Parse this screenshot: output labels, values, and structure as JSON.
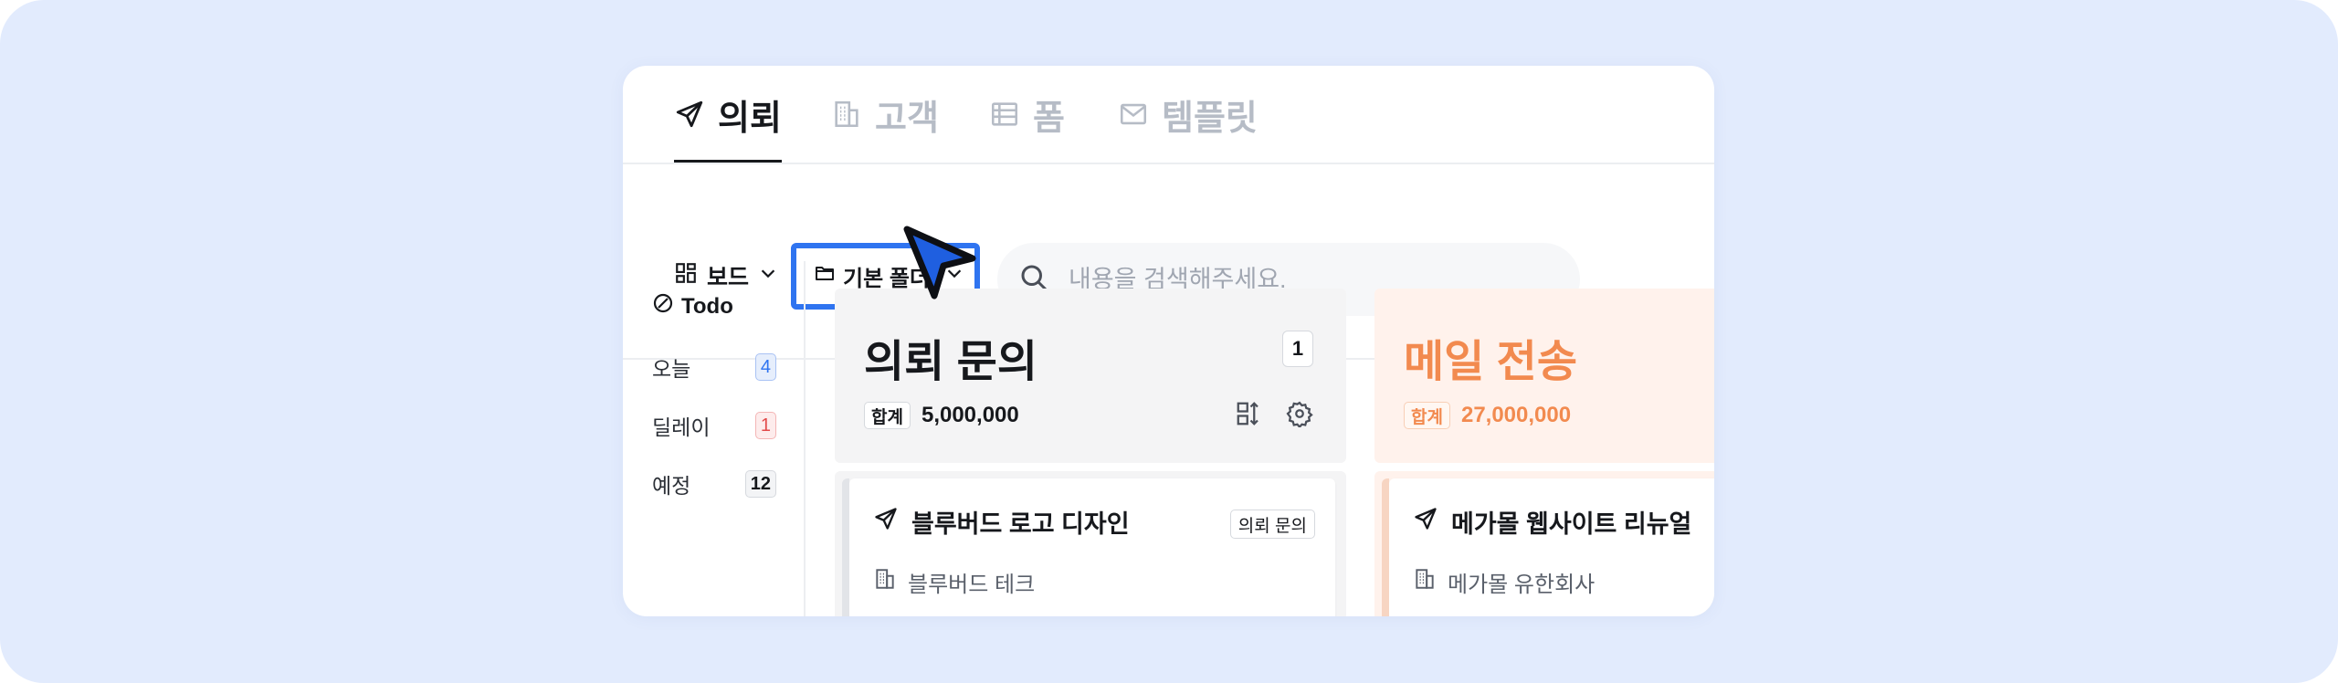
{
  "tabs": [
    {
      "label": "의뢰",
      "icon": "paper-plane-icon",
      "active": true
    },
    {
      "label": "고객",
      "icon": "building-icon",
      "active": false
    },
    {
      "label": "폼",
      "icon": "form-icon",
      "active": false
    },
    {
      "label": "템플릿",
      "icon": "mail-icon",
      "active": false
    }
  ],
  "toolbar": {
    "view_label": "보드",
    "folder_label": "기본 폴더",
    "search_placeholder": "내용을 검색해주세요."
  },
  "sidebar": {
    "heading": "Todo",
    "items": [
      {
        "label": "오늘",
        "count": "4",
        "color": "#2f74f0"
      },
      {
        "label": "딜레이",
        "count": "1",
        "color": "#e24a4a"
      },
      {
        "label": "예정",
        "count": "12",
        "color": "#16181c"
      }
    ]
  },
  "columns": [
    {
      "title": "의뢰 문의",
      "count": "1",
      "sum_label": "합계",
      "sum_value": "5,000,000",
      "card": {
        "title": "블루버드 로고 디자인",
        "tag": "의뢰 문의",
        "company": "블루버드 테크"
      }
    },
    {
      "title": "메일 전송",
      "sum_label": "합계",
      "sum_value": "27,000,000",
      "color": "#f28a4f",
      "card": {
        "title": "메가몰 웹사이트 리뉴얼",
        "company": "메가몰 유한회사"
      }
    }
  ],
  "colors": {
    "accent": "#2f74f0",
    "orange": "#f28a4f",
    "background": "#e2ebfd"
  }
}
